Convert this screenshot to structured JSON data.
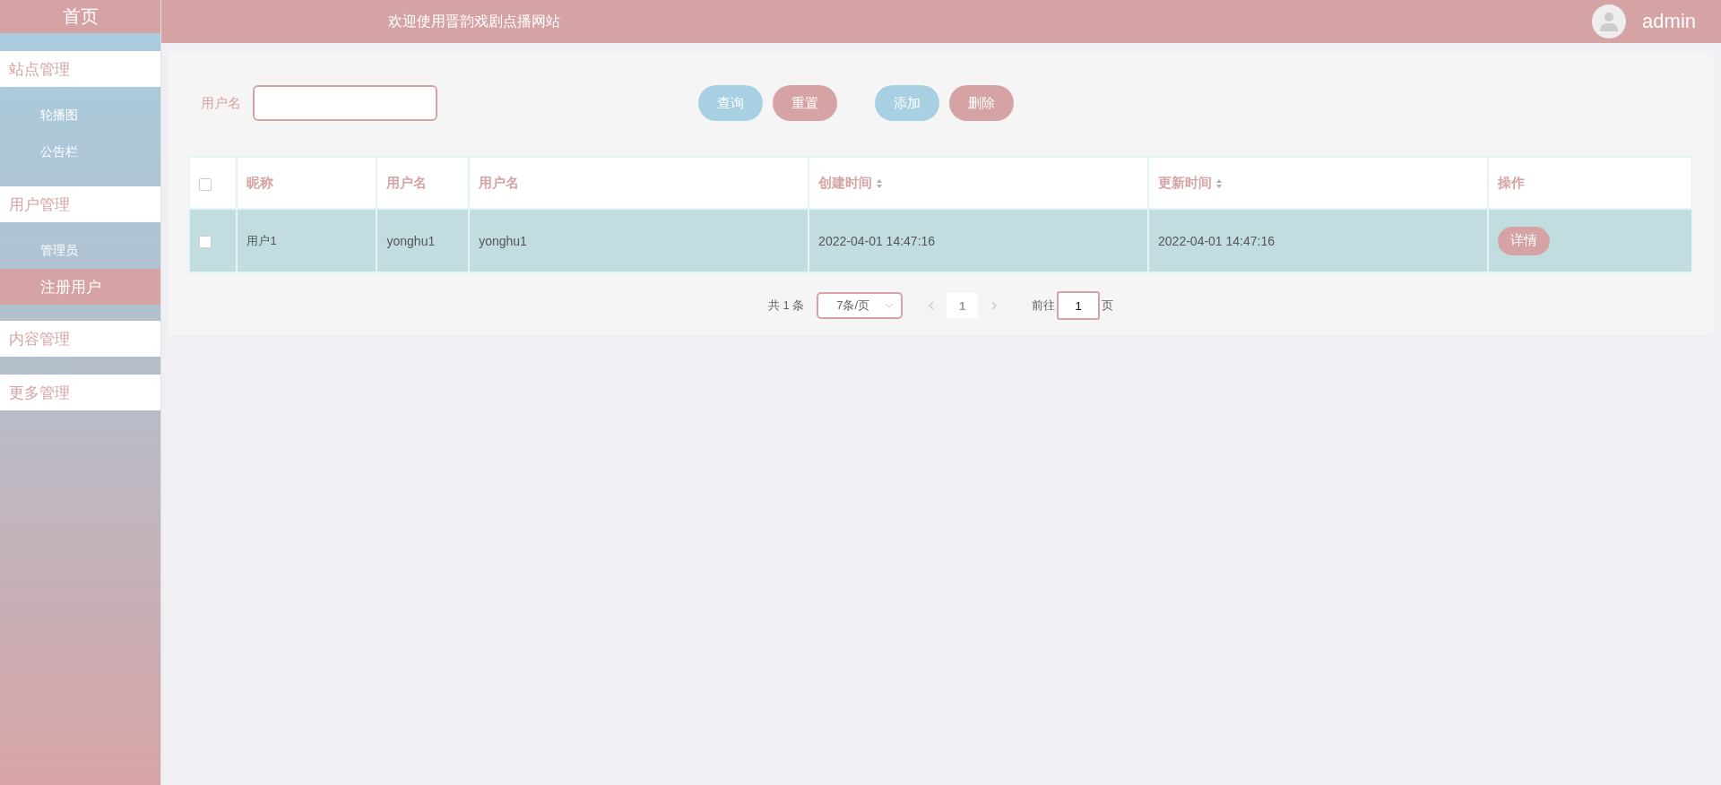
{
  "sidebar": {
    "home": "首页",
    "groups": [
      {
        "title": "站点管理",
        "items": [
          {
            "label": "轮播图",
            "selected": false
          },
          {
            "label": "公告栏",
            "selected": false
          }
        ]
      },
      {
        "title": "用户管理",
        "items": [
          {
            "label": "管理员",
            "selected": false
          },
          {
            "label": "注册用户",
            "selected": true
          }
        ]
      },
      {
        "title": "内容管理"
      },
      {
        "title": "更多管理"
      }
    ]
  },
  "header": {
    "title": "欢迎使用晋韵戏剧点播网站",
    "user": "admin"
  },
  "search": {
    "label": "用户名"
  },
  "buttons": [
    {
      "label": "查询",
      "kind": "primary"
    },
    {
      "label": "重置",
      "kind": "secondary"
    },
    {
      "label": "添加",
      "kind": "primary"
    },
    {
      "label": "删除",
      "kind": "secondary"
    }
  ],
  "table": {
    "select_all_checked": false,
    "columns": [
      {
        "label": "昵称",
        "sortable": false
      },
      {
        "label": "用户名",
        "sortable": false
      },
      {
        "label": "用户名",
        "sortable": false
      },
      {
        "label": "创建时间",
        "sortable": true
      },
      {
        "label": "更新时间",
        "sortable": true
      },
      {
        "label": "操作",
        "sortable": false
      }
    ],
    "rows": [
      {
        "checked": false,
        "cells": [
          "用户1",
          "yonghu1",
          "yonghu1",
          "2022-04-01 14:47:16",
          "2022-04-01 14:47:16"
        ],
        "action": "详情"
      }
    ]
  },
  "pagination": {
    "total": "共 1 条",
    "page_size": "7条/页",
    "pages": [
      {
        "label": "1",
        "selected": true
      }
    ],
    "goto_label": "前往",
    "goto_value": "1",
    "goto_suffix": "页"
  }
}
